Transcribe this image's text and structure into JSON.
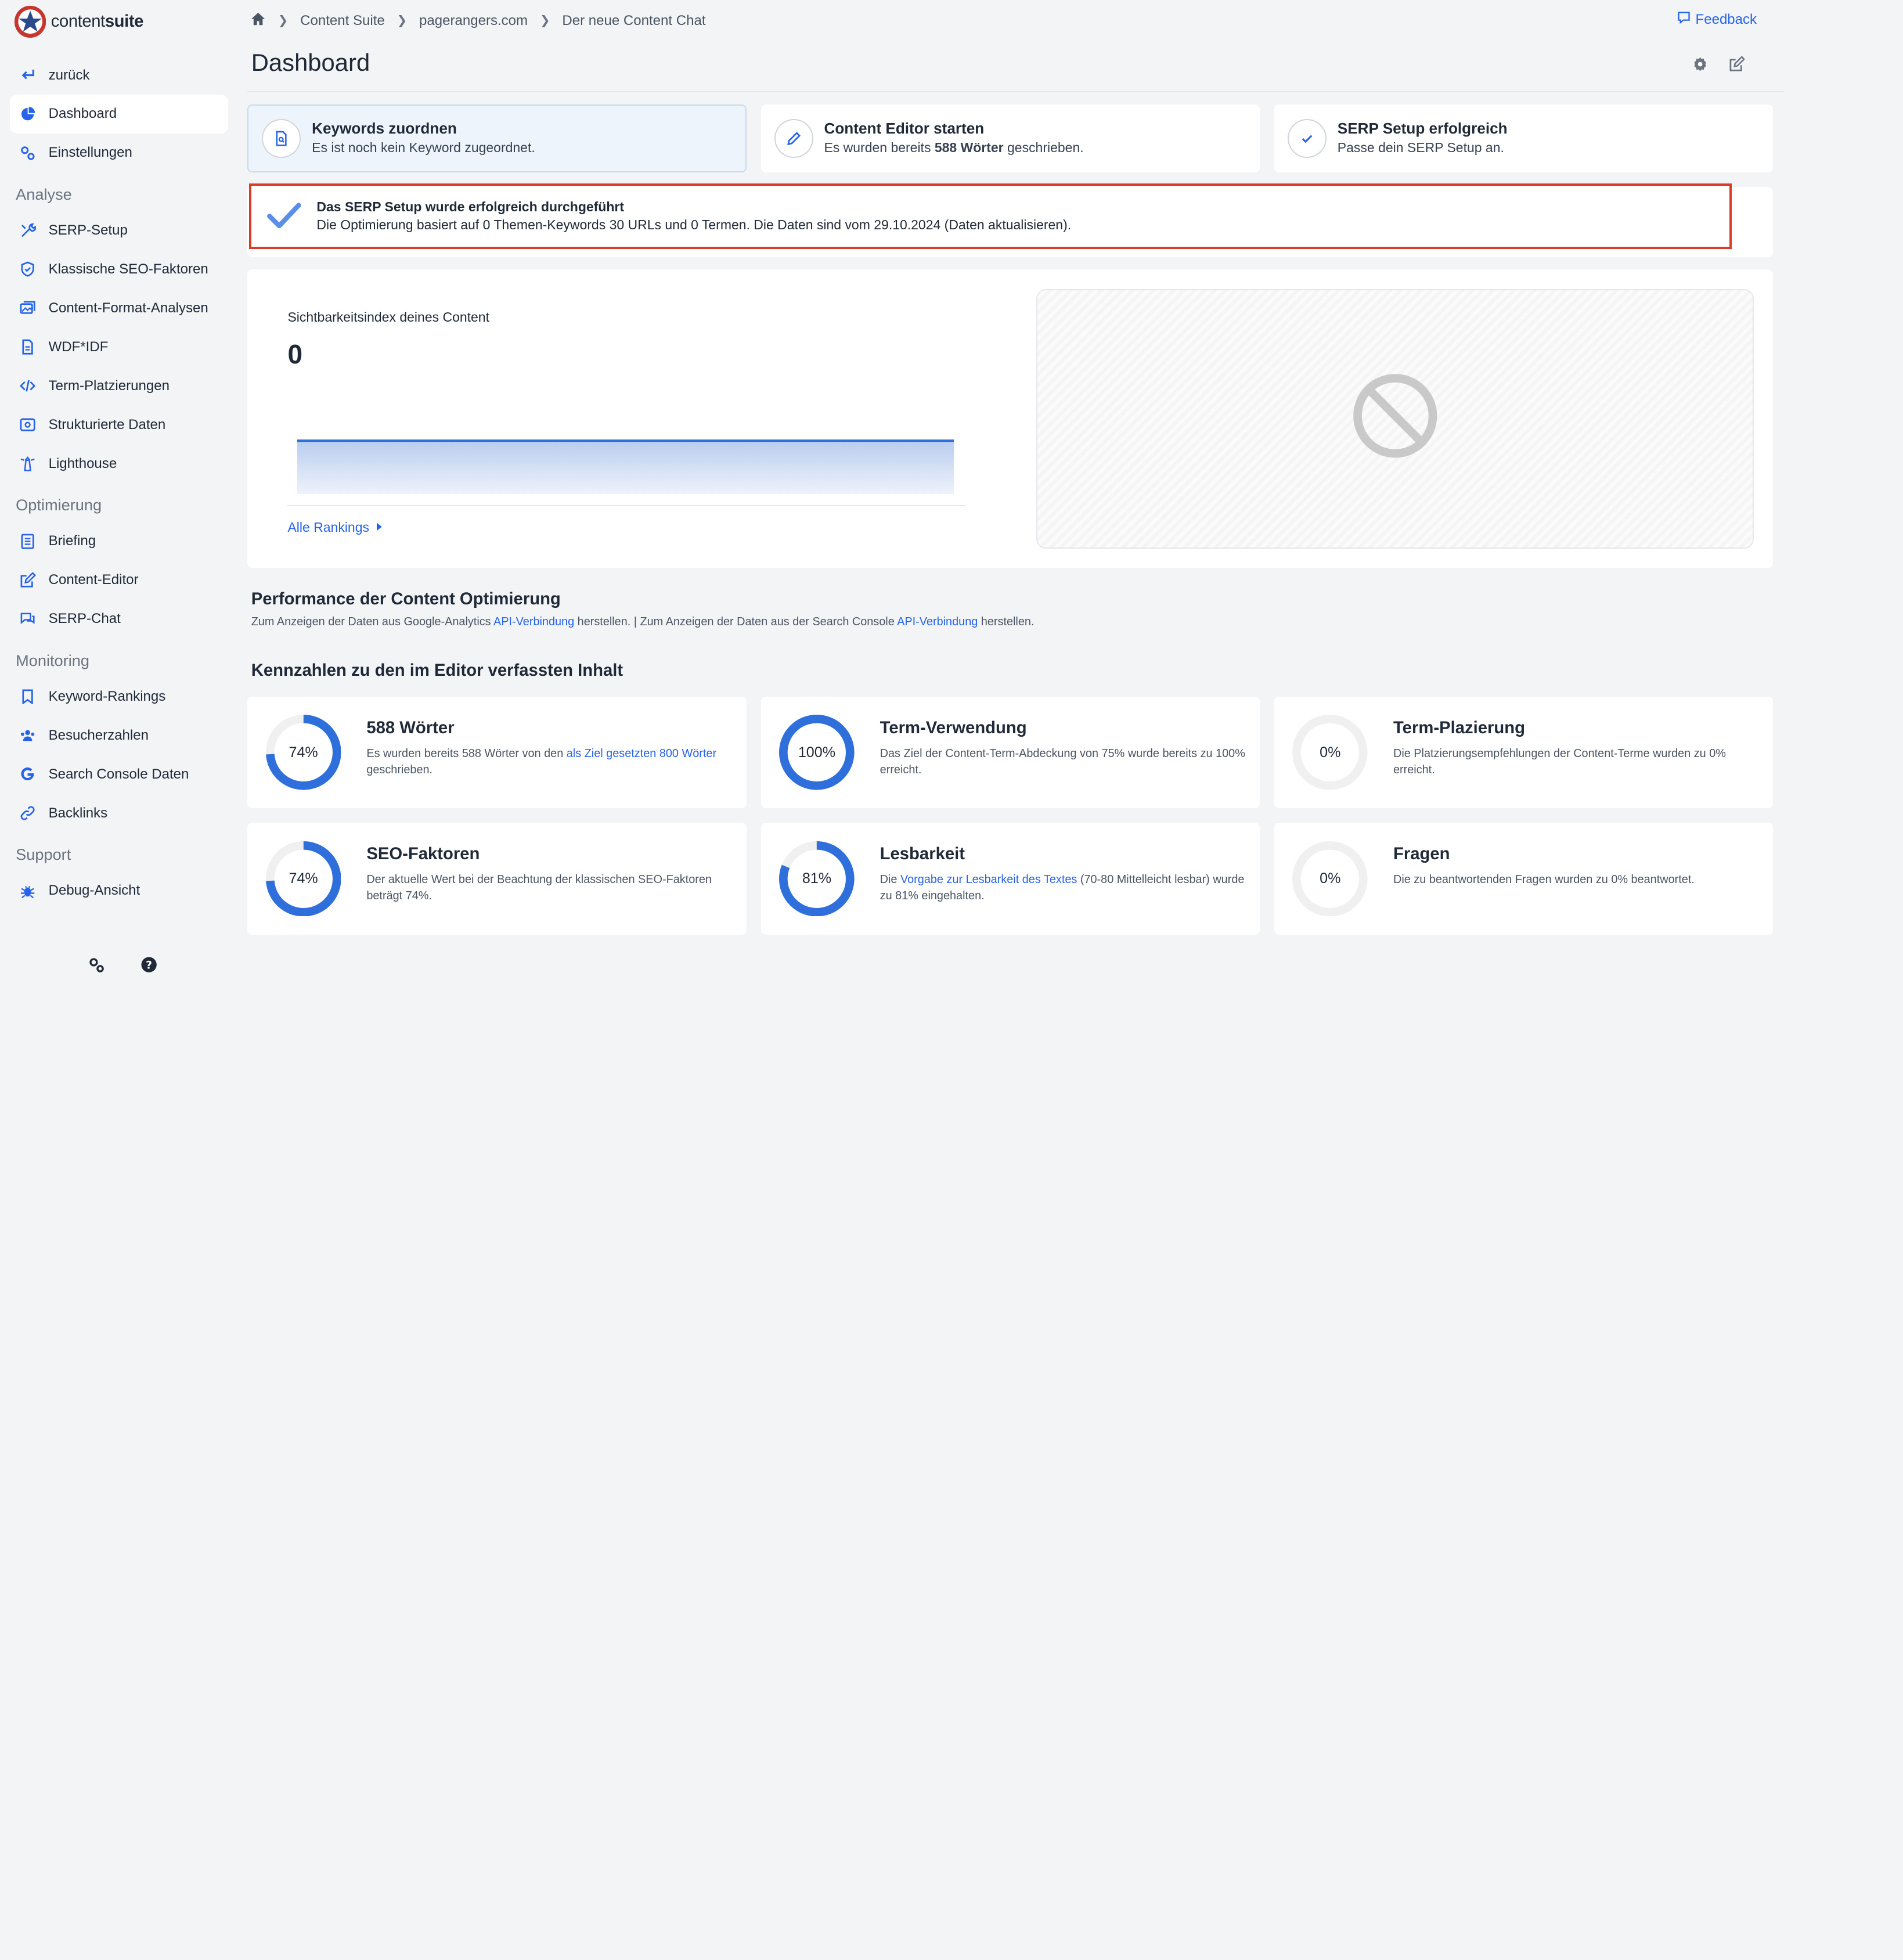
{
  "brand": {
    "name_light": "content",
    "name_bold": "suite"
  },
  "sidebar": {
    "top_items": [
      {
        "label": "zurück",
        "icon": "return-arrow-icon"
      },
      {
        "label": "Dashboard",
        "icon": "pie-chart-icon"
      },
      {
        "label": "Einstellungen",
        "icon": "gears-icon"
      }
    ],
    "sections": [
      {
        "title": "Analyse",
        "items": [
          {
            "label": "SERP-Setup",
            "icon": "tools-icon"
          },
          {
            "label": "Klassische SEO-Faktoren",
            "icon": "shield-icon"
          },
          {
            "label": "Content-Format-Analysen",
            "icon": "images-icon"
          },
          {
            "label": "WDF*IDF",
            "icon": "document-icon"
          },
          {
            "label": "Term-Platzierungen",
            "icon": "code-icon"
          },
          {
            "label": "Strukturierte Daten",
            "icon": "structured-data-icon"
          },
          {
            "label": "Lighthouse",
            "icon": "lighthouse-icon"
          }
        ]
      },
      {
        "title": "Optimierung",
        "items": [
          {
            "label": "Briefing",
            "icon": "list-icon"
          },
          {
            "label": "Content-Editor",
            "icon": "edit-icon"
          },
          {
            "label": "SERP-Chat",
            "icon": "chat-icon"
          }
        ]
      },
      {
        "title": "Monitoring",
        "items": [
          {
            "label": "Keyword-Rankings",
            "icon": "bookmark-icon"
          },
          {
            "label": "Besucherzahlen",
            "icon": "users-icon"
          },
          {
            "label": "Search Console Daten",
            "icon": "google-icon"
          },
          {
            "label": "Backlinks",
            "icon": "link-icon"
          }
        ]
      },
      {
        "title": "Support",
        "items": [
          {
            "label": "Debug-Ansicht",
            "icon": "bug-icon"
          }
        ]
      }
    ]
  },
  "breadcrumb": [
    "Content Suite",
    "pagerangers.com",
    "Der neue Content Chat"
  ],
  "feedback_label": "Feedback",
  "page_title": "Dashboard",
  "steps": [
    {
      "title": "Keywords zuordnen",
      "desc": "Es ist noch kein Keyword zugeordnet.",
      "icon": "document-search-icon"
    },
    {
      "title": "Content Editor starten",
      "desc_pre": "Es wurden bereits ",
      "desc_bold": "588 Wörter",
      "desc_post": " geschrieben.",
      "icon": "pencil-icon"
    },
    {
      "title": "SERP Setup erfolgreich",
      "desc": "Passe dein SERP Setup an.",
      "icon": "check-icon"
    }
  ],
  "alert": {
    "title": "Das SERP Setup wurde erfolgreich durchgeführt",
    "desc": "Die Optimierung basiert auf 0 Themen-Keywords 30 URLs und 0 Termen. Die Daten sind vom 29.10.2024 (Daten aktualisieren)."
  },
  "visibility": {
    "label": "Sichtbarkeitsindex deines Content",
    "value": "0",
    "link": "Alle Rankings"
  },
  "performance": {
    "title": "Performance der Content Optimierung",
    "desc_1": "Zum Anzeigen der Daten aus Google-Analytics ",
    "link_1": "API-Verbindung",
    "desc_2": " herstellen. | Zum Anzeigen der Daten aus der Search Console ",
    "link_2": "API-Verbindung",
    "desc_3": " herstellen."
  },
  "kpi_heading": "Kennzahlen zu den im Editor verfassten Inhalt",
  "kpis": [
    {
      "title": "588 Wörter",
      "percent_label": "74%",
      "percent": 74,
      "d1": "Es wurden bereits 588 Wörter von den ",
      "link": "als Ziel gesetzten 800 Wörter",
      "d2": " geschrieben."
    },
    {
      "title": "Term-Verwendung",
      "percent_label": "100%",
      "percent": 100,
      "d1": "Das Ziel der Content-Term-Abdeckung von 75% wurde bereits zu 100% erreicht.",
      "link": "",
      "d2": ""
    },
    {
      "title": "Term-Plazierung",
      "percent_label": "0%",
      "percent": 0,
      "d1": "Die Platzierungsempfehlungen der Content-Terme wurden zu 0% erreicht.",
      "link": "",
      "d2": ""
    },
    {
      "title": "SEO-Faktoren",
      "percent_label": "74%",
      "percent": 74,
      "d1": "Der aktuelle Wert bei der Beachtung der klassischen SEO-Faktoren beträgt 74%.",
      "link": "",
      "d2": ""
    },
    {
      "title": "Lesbarkeit",
      "percent_label": "81%",
      "percent": 81,
      "d1": "Die ",
      "link": "Vorgabe zur Lesbarkeit des Textes",
      "d2": " (70-80 Mittelleicht lesbar) wurde zu 81% eingehalten."
    },
    {
      "title": "Fragen",
      "percent_label": "0%",
      "percent": 0,
      "d1": "Die zu beantwortenden Fragen wurden zu 0% beantwortet.",
      "link": "",
      "d2": ""
    }
  ],
  "colors": {
    "accent": "#2563eb",
    "ring": "#2f6fdb",
    "ring_track": "#f0f0f0",
    "alert_border": "#dc3b2a"
  }
}
